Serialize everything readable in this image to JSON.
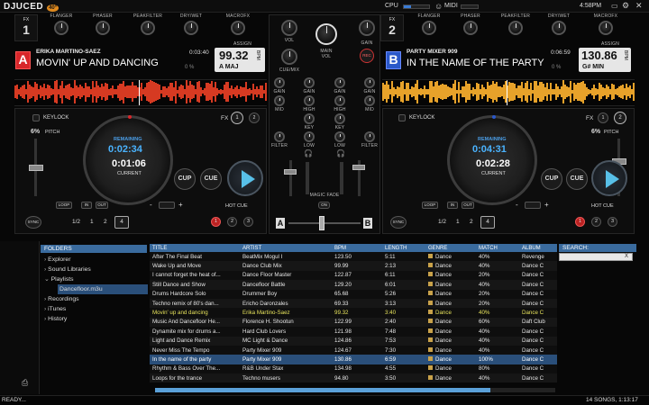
{
  "brand": {
    "logo": "DJUCED",
    "version": "40°"
  },
  "topbar": {
    "cpu_label": "CPU",
    "midi_label": "MIDI",
    "clock": "4:58PM"
  },
  "effects": {
    "left_fx": [
      "FLANGER",
      "PHASER",
      "PEAKFILTER",
      "DRY/WET",
      "MACROFX"
    ],
    "right_fx": [
      "FLANGER",
      "PHASER",
      "PEAKFILTER",
      "DRY/WET",
      "MACROFX"
    ],
    "assign": "ASSIGN"
  },
  "deck_a": {
    "fx_label": "FX",
    "fx_num": "1",
    "letter": "A",
    "artist": "ERIKA MARTINO-SAEZ",
    "title": "MOVIN' UP AND DANCING",
    "time": "0:03:40",
    "bpm": "99.32",
    "bpm_unit": "BPM",
    "key": "A MAJ",
    "key_value": "0 %",
    "keylock": "KEYLOCK",
    "fx": "FX",
    "pitch": "6%",
    "pitch_label": "PITCH",
    "remaining_label": "REMAINING",
    "remaining": "0:02:34",
    "current": "0:01:06",
    "current_label": "CURRENT",
    "cup": "CUP",
    "cue": "CUE",
    "loop": "LOOP",
    "in": "IN",
    "out": "OUT",
    "hotcue": "HOT CUE",
    "sync": "SYNC",
    "fx1": "1",
    "fx2": "2",
    "loops": [
      "1/2",
      "1",
      "2",
      "4"
    ],
    "cues": [
      "1",
      "2",
      "3"
    ],
    "minus": "-",
    "plus": "+"
  },
  "deck_b": {
    "fx_label": "FX",
    "fx_num": "2",
    "letter": "B",
    "artist": "PARTY MIXER 909",
    "title": "IN THE NAME OF THE PARTY",
    "time": "0:06:59",
    "bpm": "130.86",
    "bpm_unit": "BPM",
    "key": "G# MIN",
    "key_value": "0 %",
    "keylock": "KEYLOCK",
    "fx": "FX",
    "pitch": "6%",
    "pitch_label": "PITCH",
    "remaining_label": "REMAINING",
    "remaining": "0:04:31",
    "current": "0:02:28",
    "current_label": "CURRENT",
    "cup": "CUP",
    "cue": "CUE",
    "loop": "LOOP",
    "in": "IN",
    "out": "OUT",
    "hotcue": "HOT CUE",
    "sync": "SYNC",
    "fx1": "1",
    "fx2": "2",
    "loops": [
      "1/2",
      "1",
      "2",
      "4"
    ],
    "cues": [
      "1",
      "2",
      "3"
    ],
    "minus": "-",
    "plus": "+"
  },
  "mixer": {
    "vol": "VOL",
    "main_vol": "MAIN\nVOL",
    "gain": "GAIN",
    "cue_mix": "CUE/MIX",
    "rec": "REC",
    "eq": [
      "GAIN",
      "HIGH",
      "KEY",
      "MID",
      "KEY",
      "LOW",
      "FILTER"
    ],
    "high": "HIGH",
    "mid": "MID",
    "low": "LOW",
    "key": "KEY",
    "filter": "FILTER",
    "magic_fade": "MAGIC FADE",
    "on": "ON",
    "xa": "A",
    "xb": "B"
  },
  "browser": {
    "folders_header": "FOLDERS",
    "tree": [
      "Explorer",
      "Sound Libraries",
      "Playlists",
      "Dancefloor.m3u",
      "Recordings",
      "iTunes",
      "History"
    ],
    "search_header": "SEARCH:",
    "search_clear": "X",
    "columns": [
      "TITLE",
      "ARTIST",
      "BPM",
      "LENGTH",
      "GENRE",
      "MATCH",
      "ALBUM"
    ],
    "rows": [
      [
        "After The Final Beat",
        "BeatMix Mogul I",
        "123.50",
        "5:11",
        "Dance",
        "40%",
        "Revenge"
      ],
      [
        "Wake Up and Move",
        "Dance Club Mix",
        "99.99",
        "2:13",
        "Dance",
        "40%",
        "Dance C"
      ],
      [
        "I cannot forget the heat of...",
        "Dance Floor Master",
        "122.87",
        "6:11",
        "Dance",
        "20%",
        "Dance C"
      ],
      [
        "Still Dance and Show",
        "Dancefloor Battle",
        "129.20",
        "6:01",
        "Dance",
        "40%",
        "Dance C"
      ],
      [
        "Drums Hardcore Solo",
        "Drummer Boy",
        "65.68",
        "5:26",
        "Dance",
        "20%",
        "Dance C"
      ],
      [
        "Techno remix of 80's dan...",
        "Ericho Daronzales",
        "69.33",
        "3:13",
        "Dance",
        "20%",
        "Dance C"
      ],
      [
        "Movin' up and dancing",
        "Erika Martino-Saez",
        "99.32",
        "3:40",
        "Dance",
        "40%",
        "Dance C"
      ],
      [
        "Music And Dancefloor He...",
        "Florence H. Shootun",
        "122.99",
        "2:40",
        "Dance",
        "60%",
        "Daft Club"
      ],
      [
        "Dynamite mix for drums a...",
        "Hard Club Lovers",
        "121.98",
        "7:48",
        "Dance",
        "40%",
        "Dance C"
      ],
      [
        "Light and Dance Remix",
        "MC Light & Dance",
        "124.86",
        "7:53",
        "Dance",
        "40%",
        "Dance C"
      ],
      [
        "Never Miss The Tempo",
        "Party Mixer 909",
        "124.67",
        "7:30",
        "Dance",
        "40%",
        "Dance C"
      ],
      [
        "In the name of the party",
        "Party Mixer 909",
        "130.86",
        "6:59",
        "Dance",
        "100%",
        "Dance C"
      ],
      [
        "Rhythm & Bass Over The...",
        "R&B Under Stax",
        "134.98",
        "4:55",
        "Dance",
        "80%",
        "Dance C"
      ],
      [
        "Loops for the trance",
        "Techno musers",
        "94.80",
        "3:50",
        "Dance",
        "40%",
        "Dance C"
      ]
    ]
  },
  "status": {
    "left": "READY...",
    "right": "14 SONGS, 1:13:17"
  },
  "colors": {
    "deck_a": "#d8262a",
    "deck_b": "#2a58c9",
    "accent": "#3a6b9e",
    "highlight": "#e6e25c"
  }
}
